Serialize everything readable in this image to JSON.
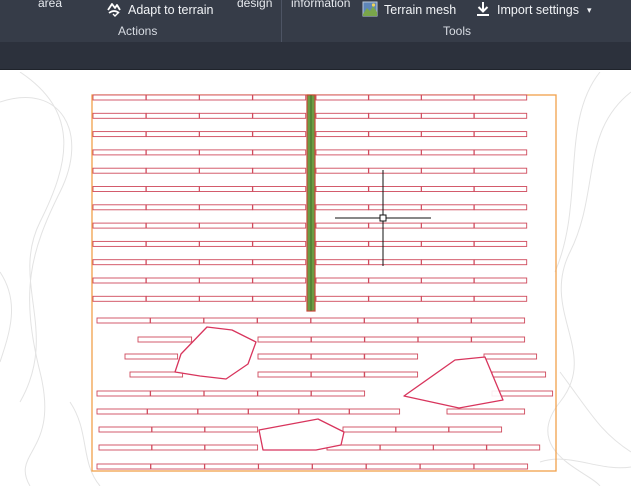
{
  "ribbon": {
    "actions": {
      "fragment_left": "area",
      "adapt_label": "Adapt to terrain",
      "fragment_right": "design",
      "group_label": "Actions"
    },
    "tools": {
      "fragment": "information",
      "terrain_mesh_label": "Terrain mesh",
      "import_settings_label": "Import settings",
      "group_label": "Tools"
    }
  },
  "canvas": {
    "colors": {
      "boundary": "#f2a04a",
      "rows": "#cf4a5c",
      "obstacle": "#d8355d",
      "road_fill": "#6b9b43",
      "road_edge": "#c8483a",
      "contour": "#e3e3e3",
      "cursor": "#111111"
    },
    "cursor": "crosshair-cursor"
  }
}
